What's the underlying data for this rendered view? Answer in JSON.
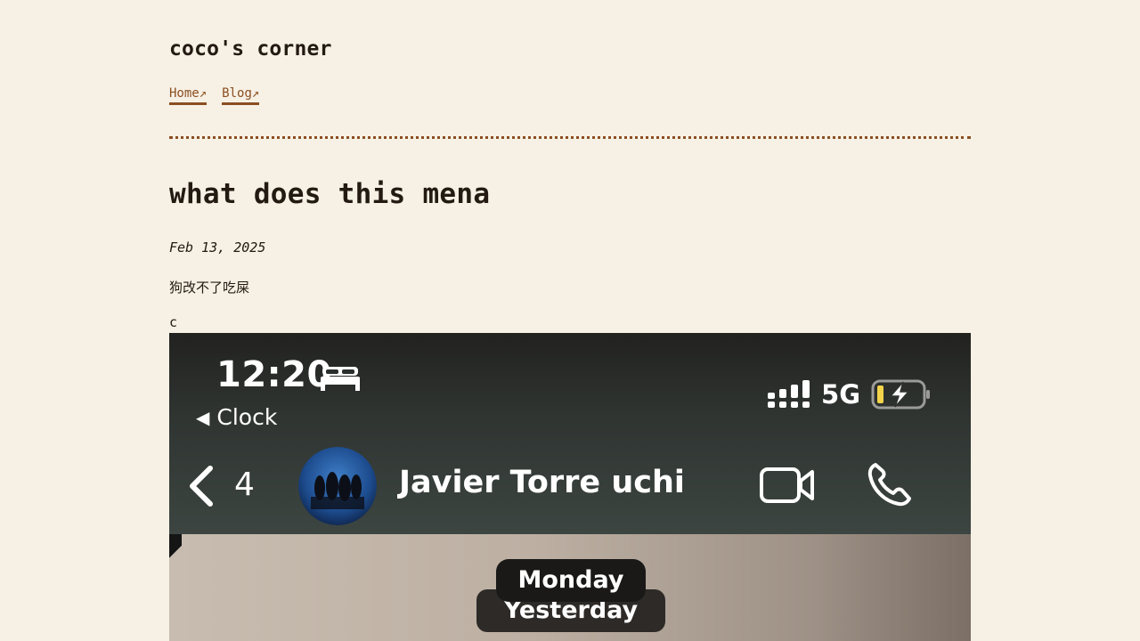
{
  "site": {
    "title": "coco's corner",
    "nav": [
      {
        "label": "Home↗"
      },
      {
        "label": "Blog↗"
      }
    ]
  },
  "post": {
    "title": "what does this mena",
    "date": "Feb 13, 2025",
    "body": [
      "狗改不了吃屎",
      "c"
    ]
  },
  "screenshot": {
    "time": "12:20",
    "back_label": "Clock",
    "network": "5G",
    "unread_count": "4",
    "contact_name": "Javier Torre uchi",
    "day_labels": [
      "Monday",
      "Yesterday"
    ],
    "icons": [
      "bed-icon",
      "back-triangle-icon",
      "signal-bars-icon",
      "battery-charging-icon",
      "chevron-left-icon",
      "avatar",
      "video-call-icon",
      "phone-call-icon"
    ],
    "colors": {
      "battery_fill": "#f2d34a",
      "header_bg": "#2f3431"
    }
  },
  "colors": {
    "background": "#f7f0e4",
    "accent": "#8a4f22",
    "text": "#231a12"
  }
}
